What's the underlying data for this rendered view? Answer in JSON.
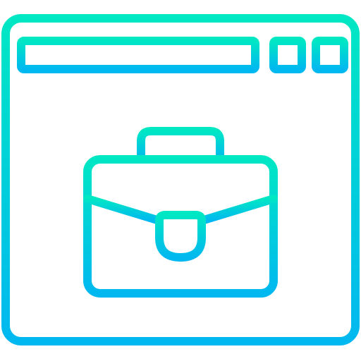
{
  "icon": {
    "semantic": "browser-window-with-briefcase-icon",
    "parts": [
      "browser-window-icon",
      "address-bar",
      "window-button-left",
      "window-button-right",
      "briefcase-icon"
    ]
  },
  "colors": {
    "gradient_top": "#00E7C4",
    "gradient_bottom": "#00B8F0",
    "background": "#FFFFFF"
  }
}
